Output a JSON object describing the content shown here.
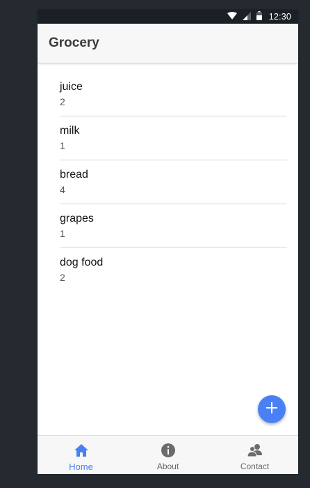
{
  "status_bar": {
    "time": "12:30",
    "icons": [
      "wifi-icon",
      "signal-icon",
      "battery-icon"
    ]
  },
  "header": {
    "title": "Grocery"
  },
  "list": {
    "items": [
      {
        "name": "juice",
        "quantity": "2"
      },
      {
        "name": "milk",
        "quantity": "1"
      },
      {
        "name": "bread",
        "quantity": "4"
      },
      {
        "name": "grapes",
        "quantity": "1"
      },
      {
        "name": "dog food",
        "quantity": "2"
      }
    ]
  },
  "fab": {
    "icon": "plus-icon",
    "color": "#4a80f5"
  },
  "bottom_nav": {
    "items": [
      {
        "label": "Home",
        "icon": "home-icon",
        "active": true
      },
      {
        "label": "About",
        "icon": "info-icon",
        "active": false
      },
      {
        "label": "Contact",
        "icon": "contact-icon",
        "active": false
      }
    ],
    "active_color": "#4a80f5",
    "inactive_color": "#666666"
  }
}
